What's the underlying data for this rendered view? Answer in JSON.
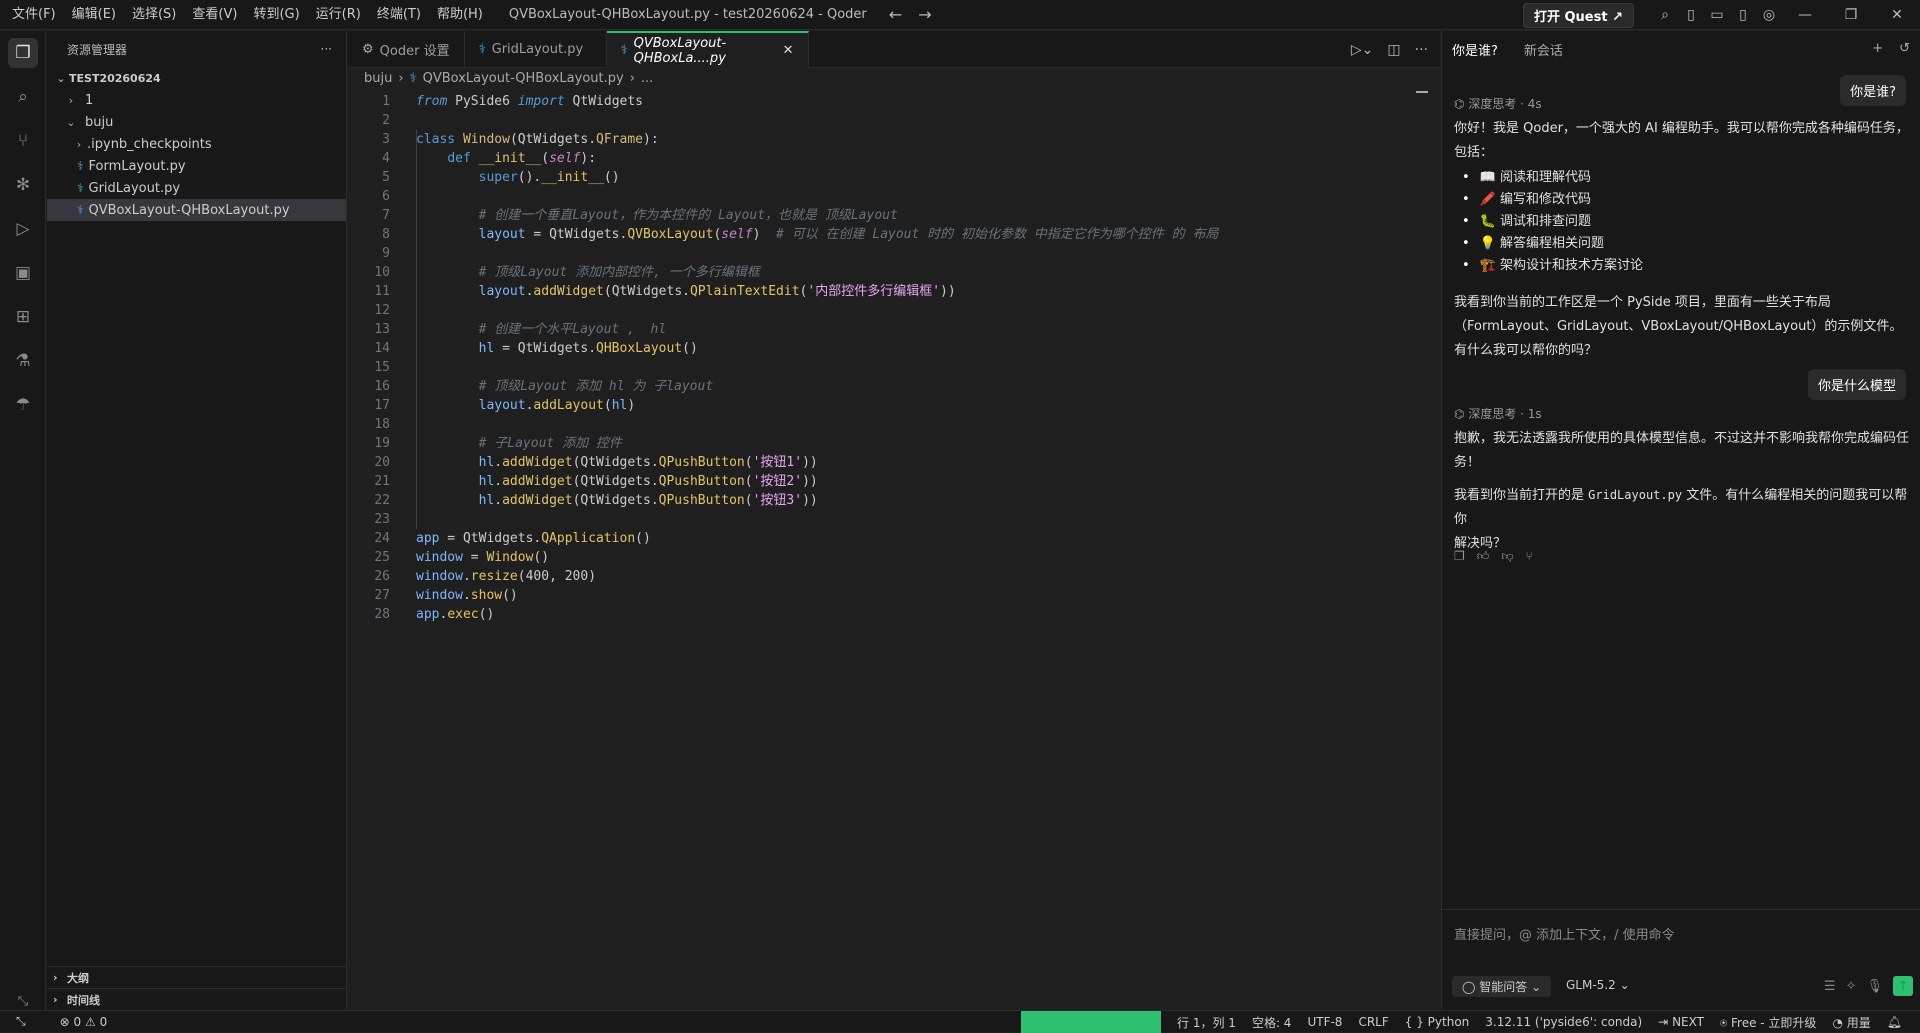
{
  "titlebar": {
    "menus": [
      "文件(F)",
      "编辑(E)",
      "选择(S)",
      "查看(V)",
      "转到(G)",
      "运行(R)",
      "终端(T)",
      "帮助(H)"
    ],
    "window_title": "QVBoxLayout-QHBoxLayout.py - test20260624 - Qoder",
    "quest_label": "打开 Quest",
    "quest_icon": "external-link-icon"
  },
  "activity": [
    "explorer-icon",
    "search-icon",
    "source-control-icon",
    "extensions-icon",
    "run-debug-icon",
    "remote-icon",
    "packages-icon",
    "testing-icon",
    "deploy-icon"
  ],
  "sidebar": {
    "title": "资源管理器",
    "more": "···",
    "root": "TEST20260624",
    "items": [
      {
        "label": "1",
        "type": "folder-collapsed",
        "depth": 1
      },
      {
        "label": "buju",
        "type": "folder-open",
        "depth": 1
      },
      {
        "label": ".ipynb_checkpoints",
        "type": "folder-collapsed",
        "depth": 2
      },
      {
        "label": "FormLayout.py",
        "type": "py",
        "depth": 2
      },
      {
        "label": "GridLayout.py",
        "type": "py",
        "depth": 2
      },
      {
        "label": "QVBoxLayout-QHBoxLayout.py",
        "type": "py",
        "depth": 2,
        "selected": true
      }
    ],
    "outline": "大纲",
    "timeline": "时间线"
  },
  "tabs": [
    {
      "label": "Qoder 设置",
      "icon": "settings-icon"
    },
    {
      "label": "GridLayout.py",
      "icon": "python-icon"
    },
    {
      "label": "QVBoxLayout-QHBoxLa....py",
      "icon": "python-icon",
      "active": true
    }
  ],
  "breadcrumb": {
    "folder": "buju",
    "file": "QVBoxLayout-QHBoxLayout.py",
    "more": "..."
  },
  "code": {
    "line_numbers": [
      "1",
      "2",
      "3",
      "4",
      "5",
      "6",
      "7",
      "8",
      "9",
      "10",
      "11",
      "12",
      "13",
      "14",
      "15",
      "16",
      "17",
      "18",
      "19",
      "20",
      "21",
      "22",
      "23",
      "24",
      "25",
      "26",
      "27",
      "28"
    ],
    "tokens": {
      "from": "from",
      "pyside": " PySide6 ",
      "import": "import",
      "qtwidgets": " QtWidgets",
      "l3_class": "class ",
      "l3_window": "Window",
      "l3_rest": "(QtWidgets.",
      "l3_qframe": "QFrame",
      "l3_end": "):",
      "l4_def": "def ",
      "l4_init": "__init__",
      "l4_p": "(",
      "l4_self": "self",
      "l4_end": "):",
      "l5_super": "super",
      "l5_rest": "().",
      "l5_init": "__init__",
      "l5_end": "()",
      "l7_cmt": "# 创建一个垂直Layout，作为本控件的 Layout，也就是 顶级Layout",
      "l8_layout": "layout",
      "l8_eq": " = QtWidgets.",
      "l8_cls": "QVBoxLayout",
      "l8_p": "(",
      "l8_self": "self",
      "l8_pe": ")",
      "l8_cmt": "  # 可以 在创建 Layout 时的 初始化参数 中指定它作为哪个控件 的 布局",
      "l10_cmt": "# 顶级Layout 添加内部控件, 一个多行编辑框",
      "l11_layout": "layout",
      "l11_dot": ".",
      "l11_fn": "addWidget",
      "l11_mid": "(QtWidgets.",
      "l11_cls": "QPlainTextEdit",
      "l11_p": "(",
      "l11_str": "'内部控件多行编辑框'",
      "l11_end": "))",
      "l13_cmt": "# 创建一个水平Layout ,  hl",
      "l14_hl": "hl",
      "l14_eq": " = QtWidgets.",
      "l14_cls": "QHBoxLayout",
      "l14_end": "()",
      "l16_cmt": "# 顶级Layout 添加 hl 为 子layout",
      "l17_layout": "layout",
      "l17_dot": ".",
      "l17_fn": "addLayout",
      "l17_p": "(",
      "l17_hl": "hl",
      "l17_end": ")",
      "l19_cmt": "# 子Layout 添加 控件",
      "l20_hl": "hl",
      "l20_dot": ".",
      "l20_fn": "addWidget",
      "l20_mid": "(QtWidgets.",
      "l20_cls": "QPushButton",
      "l20_p": "(",
      "l20_str": "'按钮1'",
      "l20_end": "))",
      "l21_hl": "hl",
      "l21_dot": ".",
      "l21_fn": "addWidget",
      "l21_mid": "(QtWidgets.",
      "l21_cls": "QPushButton",
      "l21_p": "(",
      "l21_str": "'按钮2'",
      "l21_end": "))",
      "l22_hl": "hl",
      "l22_dot": ".",
      "l22_fn": "addWidget",
      "l22_mid": "(QtWidgets.",
      "l22_cls": "QPushButton",
      "l22_p": "(",
      "l22_str": "'按钮3'",
      "l22_end": "))",
      "l24_app": "app",
      "l24_eq": " = QtWidgets.",
      "l24_cls": "QApplication",
      "l24_end": "()",
      "l25_win": "window",
      "l25_eq": " = ",
      "l25_cls": "Window",
      "l25_end": "()",
      "l26_win": "window",
      "l26_dot": ".",
      "l26_fn": "resize",
      "l26_end": "(400, 200)",
      "l27_win": "window",
      "l27_dot": ".",
      "l27_fn": "show",
      "l27_end": "()",
      "l28_app": "app",
      "l28_dot": ".",
      "l28_fn": "exec",
      "l28_end": "()"
    }
  },
  "chat": {
    "tab_active": "你是谁?",
    "tab_new": "新会话",
    "q1": "你是谁?",
    "think1": "深度思考 · 4s",
    "a1_intro": "你好！我是 Qoder，一个强大的 AI 编程助手。我可以帮你完成各种编码任务，包括：",
    "a1_list": [
      "📖  阅读和理解代码",
      "🖍️  编写和修改代码",
      "🐛  调试和排查问题",
      "💡  解答编程相关问题",
      "🏗️  架构设计和技术方案讨论"
    ],
    "a1_outro": "我看到你当前的工作区是一个 PySide 项目，里面有一些关于布局（FormLayout、GridLayout、VBoxLayout/QHBoxLayout）的示例文件。有什么我可以帮你的吗？",
    "q2": "你是什么模型",
    "think2": "深度思考 · 1s",
    "a2_p1": "抱歉，我无法透露我所使用的具体模型信息。不过这并不影响我帮你完成编码任务！",
    "a2_p2_pre": "我看到你当前打开的是 ",
    "a2_p2_code": "GridLayout.py",
    "a2_p2_post": " 文件。有什么编程相关的问题我可以帮你",
    "a2_p3": "解决吗？",
    "input_placeholder": "直接提问，@ 添加上下文，/ 使用命令",
    "mode": "智能问答",
    "model": "GLM-5.2"
  },
  "statusbar": {
    "errors": "0",
    "warnings": "0",
    "green_text": "",
    "position": "行 1，列 1",
    "spaces": "空格: 4",
    "encoding": "UTF-8",
    "eol": "CRLF",
    "language": "Python",
    "interpreter": "3.12.11 ('pyside6': conda)",
    "next": "NEXT",
    "plan": "Free - 立即升级",
    "usage": "用量"
  }
}
